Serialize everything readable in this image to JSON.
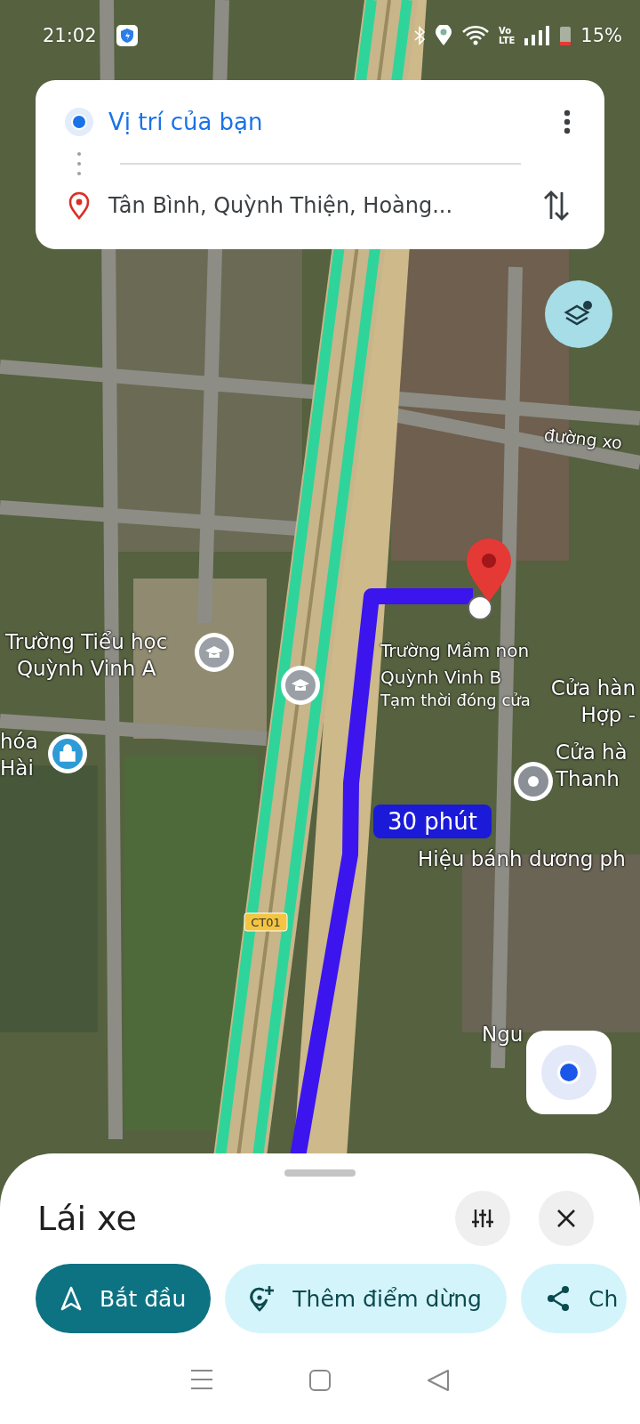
{
  "status_bar": {
    "time": "21:02",
    "network": "Vo\nLTE",
    "battery": "15%"
  },
  "route_card": {
    "origin": "Vị trí của bạn",
    "destination": "Tân Bình, Quỳnh Thiện, Hoàng..."
  },
  "map": {
    "labels": [
      {
        "kind": "road",
        "text": "đường xo"
      },
      {
        "kind": "place",
        "text": "Trường Tiểu học\nQuỳnh Vinh A"
      },
      {
        "kind": "place",
        "text": "Trường Mầm non\nQuỳnh Vinh B",
        "note": "Tạm thời đóng cửa"
      },
      {
        "kind": "place",
        "text": "Cửa hàn\nHợp -"
      },
      {
        "kind": "place",
        "text": "hóa\nHài"
      },
      {
        "kind": "place",
        "text": "Cửa hà\nThanh"
      },
      {
        "kind": "place",
        "text": "Hiệu bánh dương ph"
      },
      {
        "kind": "place",
        "text": "Ngu"
      }
    ],
    "road_shield": "CT01",
    "eta": "30 phút"
  },
  "sheet": {
    "title": "Lái xe",
    "actions": [
      {
        "kind": "start",
        "label": "Bắt đầu"
      },
      {
        "kind": "add_stop",
        "label": "Thêm điểm dừng"
      },
      {
        "kind": "share",
        "label": "Ch"
      }
    ]
  }
}
